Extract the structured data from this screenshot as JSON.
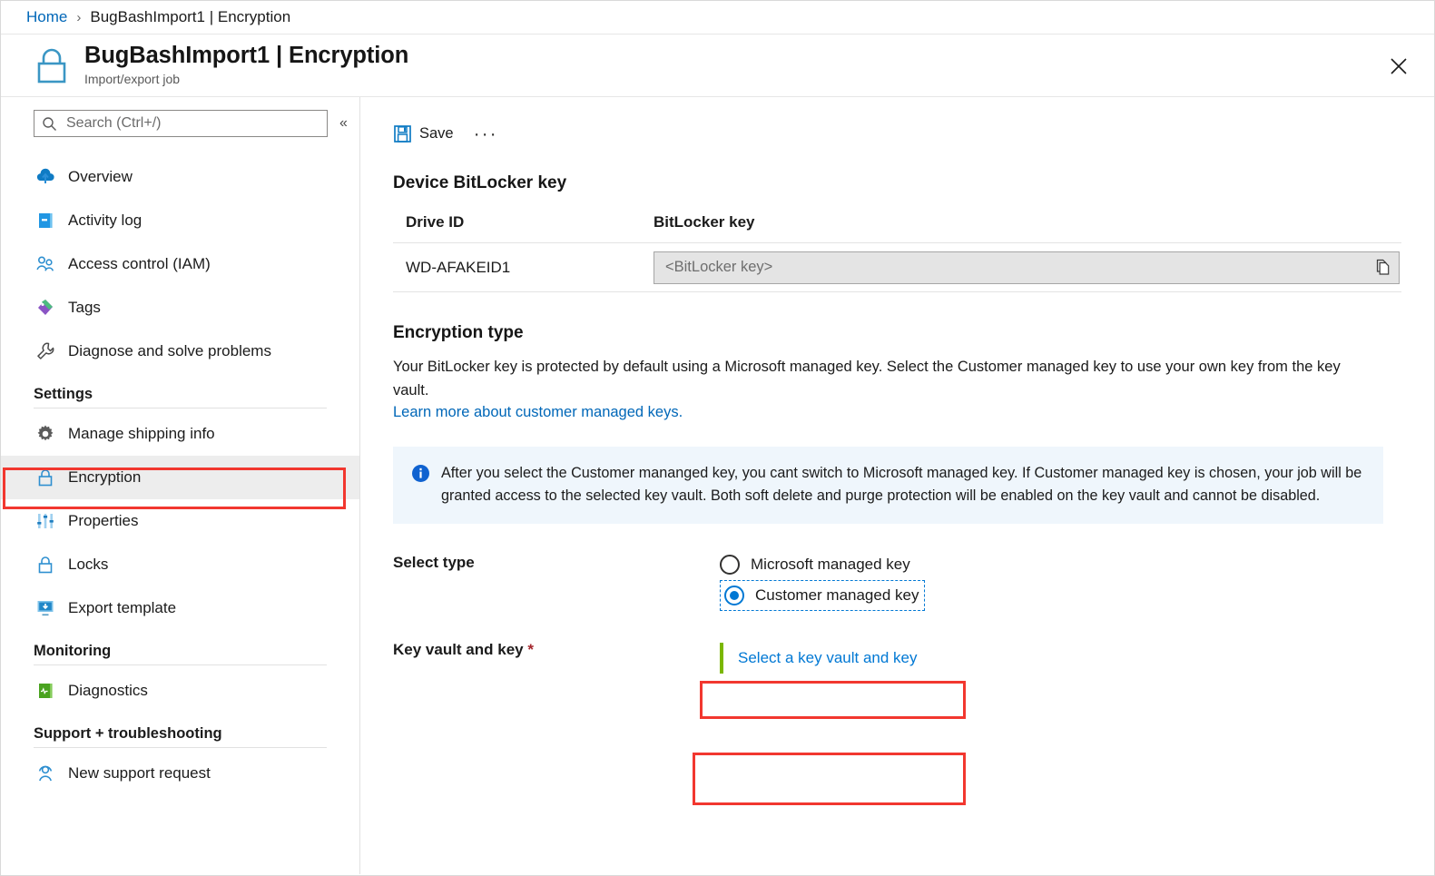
{
  "breadcrumb": {
    "home_label": "Home",
    "separator": "›",
    "current": "BugBashImport1 | Encryption"
  },
  "header": {
    "icon": "lock-icon",
    "title": "BugBashImport1 | Encryption",
    "subtitle": "Import/export job",
    "close_label": "✕"
  },
  "sidebar": {
    "search": {
      "placeholder": "Search (Ctrl+/)",
      "value": "",
      "icon": "search-icon"
    },
    "collapse_icon": "«",
    "items": [
      {
        "label": "Overview",
        "icon": "cloud-upload-icon",
        "selected": false
      },
      {
        "label": "Activity log",
        "icon": "activity-log-icon",
        "selected": false
      },
      {
        "label": "Access control (IAM)",
        "icon": "people-icon",
        "selected": false
      },
      {
        "label": "Tags",
        "icon": "tag-icon",
        "selected": false
      },
      {
        "label": "Diagnose and solve problems",
        "icon": "wrench-icon",
        "selected": false
      }
    ],
    "groups": [
      {
        "title": "Settings",
        "items": [
          {
            "label": "Manage shipping info",
            "icon": "gear-icon",
            "selected": false
          },
          {
            "label": "Encryption",
            "icon": "lock-icon",
            "selected": true
          },
          {
            "label": "Properties",
            "icon": "sliders-icon",
            "selected": false
          },
          {
            "label": "Locks",
            "icon": "lock-icon",
            "selected": false
          },
          {
            "label": "Export template",
            "icon": "export-template-icon",
            "selected": false
          }
        ]
      },
      {
        "title": "Monitoring",
        "items": [
          {
            "label": "Diagnostics",
            "icon": "diagnostics-icon",
            "selected": false
          }
        ]
      },
      {
        "title": "Support + troubleshooting",
        "items": [
          {
            "label": "New support request",
            "icon": "support-person-icon",
            "selected": false
          }
        ]
      }
    ]
  },
  "toolbar": {
    "save_label": "Save",
    "save_icon": "save-disk-icon",
    "more_label": "···"
  },
  "bitlocker": {
    "section_title": "Device BitLocker key",
    "columns": [
      "Drive ID",
      "BitLocker key"
    ],
    "rows": [
      {
        "drive_id": "WD-AFAKEID1",
        "key_value": "",
        "key_placeholder": "<BitLocker key>",
        "copy_icon": "copy-icon"
      }
    ]
  },
  "encryption_type": {
    "title": "Encryption type",
    "description": "Your BitLocker key is protected by default using a Microsoft managed key. Select the Customer managed key to use your own key from the key vault.",
    "link_label": "Learn more about customer managed keys.",
    "info_banner": {
      "icon": "info-icon",
      "text": "After you select the Customer mananged key, you cant switch to Microsoft managed key. If Customer managed key is chosen, your job will be granted access to the selected key vault. Both soft delete and purge protection will be enabled on the key vault and cannot be disabled."
    },
    "select_type": {
      "label": "Select type",
      "options": [
        {
          "label": "Microsoft managed key",
          "checked": false
        },
        {
          "label": "Customer managed key",
          "checked": true
        }
      ]
    },
    "key_vault": {
      "label": "Key vault and key",
      "required_marker": "*",
      "link_label": "Select a key vault and key"
    }
  },
  "colors": {
    "accent_blue": "#0078d4",
    "link_blue": "#0067b8",
    "annotation_red": "#f2372f",
    "banner_bg": "#eff6fc",
    "green_accent": "#7bb700",
    "required_red": "#a4262c"
  }
}
